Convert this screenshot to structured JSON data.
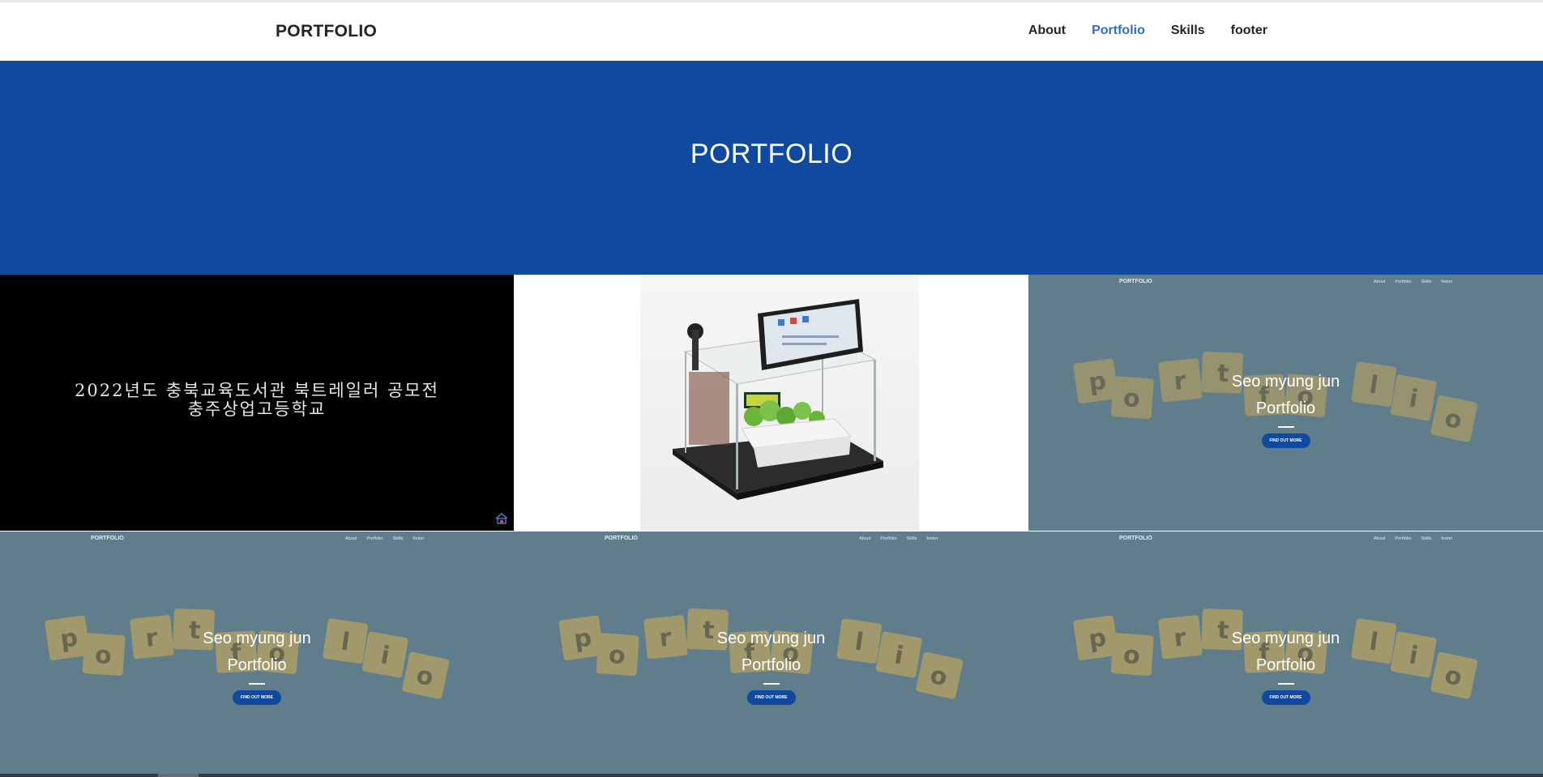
{
  "navbar": {
    "brand": "PORTFOLIO",
    "links": [
      {
        "label": "About",
        "active": false
      },
      {
        "label": "Portfolio",
        "active": true
      },
      {
        "label": "Skills",
        "active": false
      },
      {
        "label": "footer",
        "active": false
      }
    ]
  },
  "hero": {
    "title": "PORTFOLIO"
  },
  "tiles": {
    "video": {
      "line1": "2022년도  충북교육도서관  북트레일러  공모전",
      "line2": "충주상업고등학교"
    },
    "shot": {
      "mini_brand": "PORTFOLIO",
      "mini_nav": [
        "About",
        "Portfolio",
        "Skills",
        "footer"
      ],
      "name": "Seo myung jun",
      "subtitle": "Portfolio",
      "button": "FIND OUT MORE"
    }
  },
  "colors": {
    "hero_bg": "#0f49a0",
    "active_link": "#2f6fbd",
    "tile_gray": "#607d8b",
    "tile_letters": "#c3a659"
  }
}
